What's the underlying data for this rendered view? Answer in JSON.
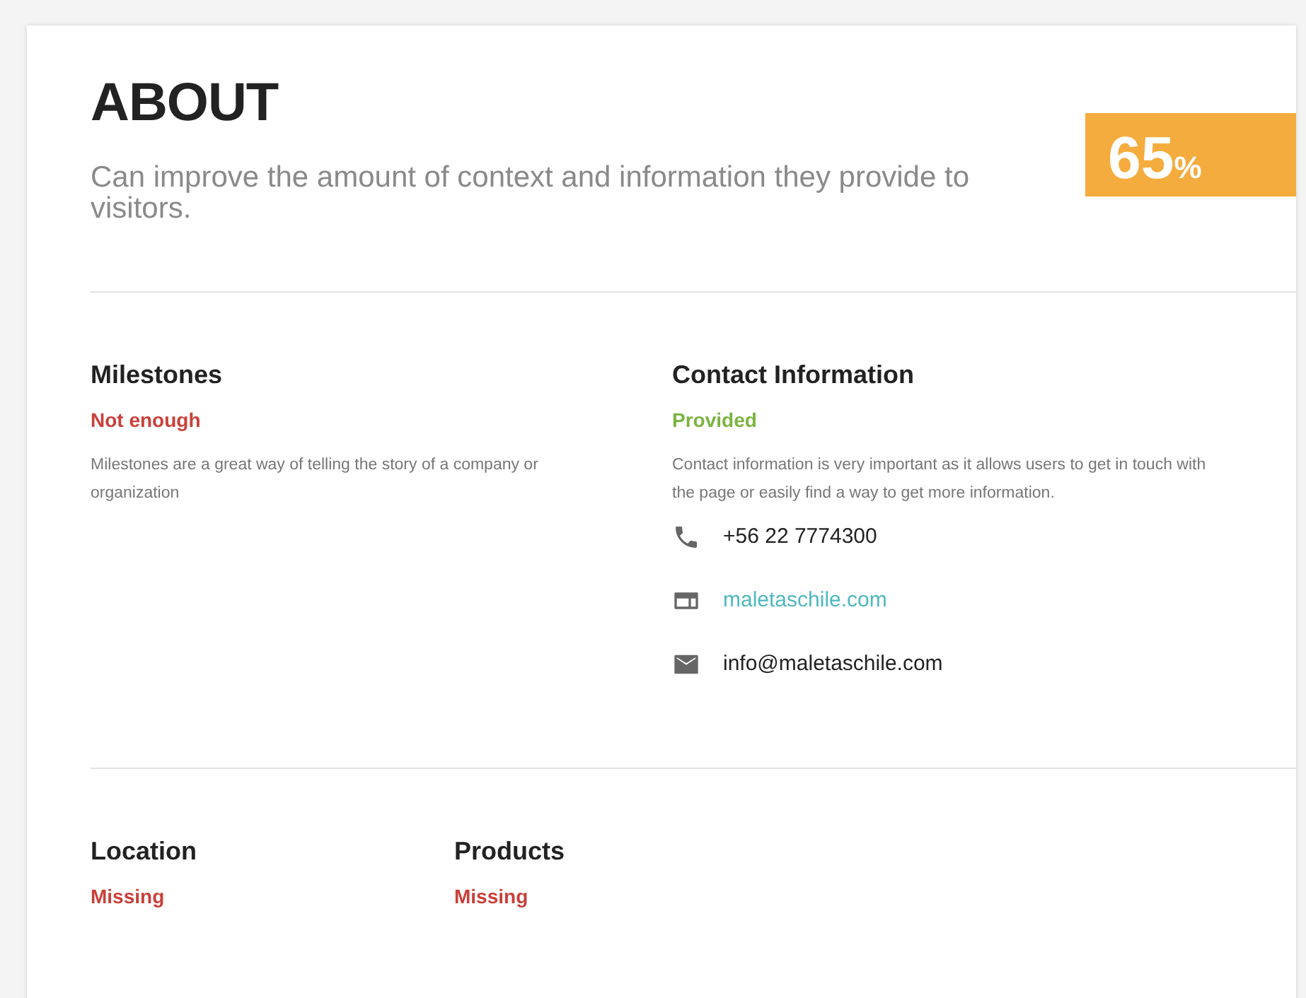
{
  "header": {
    "title": "ABOUT",
    "summary": "Can improve the amount of context and information they provide to visitors.",
    "score": {
      "value": "65",
      "unit": "%"
    }
  },
  "sections": [
    {
      "title": "Milestones",
      "status": "Not enough",
      "color": "#c9403a",
      "description": "Milestones are a great way of telling the story of a company or organization"
    },
    {
      "title": "Contact Information",
      "status": "Provided",
      "color": "#7cb342",
      "description": "Contact information is very important as it allows users to get in touch with the page or easily find a way to get more information.",
      "contacts": [
        {
          "kind": "phone",
          "text": "+56 22 7774300"
        },
        {
          "kind": "website",
          "text": "maletaschile.com"
        },
        {
          "kind": "email",
          "text": "info@maletaschile.com"
        }
      ]
    }
  ],
  "bottom_sections": [
    {
      "title": "Location",
      "status": "Missing",
      "color": "#c9403a"
    },
    {
      "title": "Products",
      "status": "Missing",
      "color": "#c9403a"
    }
  ]
}
